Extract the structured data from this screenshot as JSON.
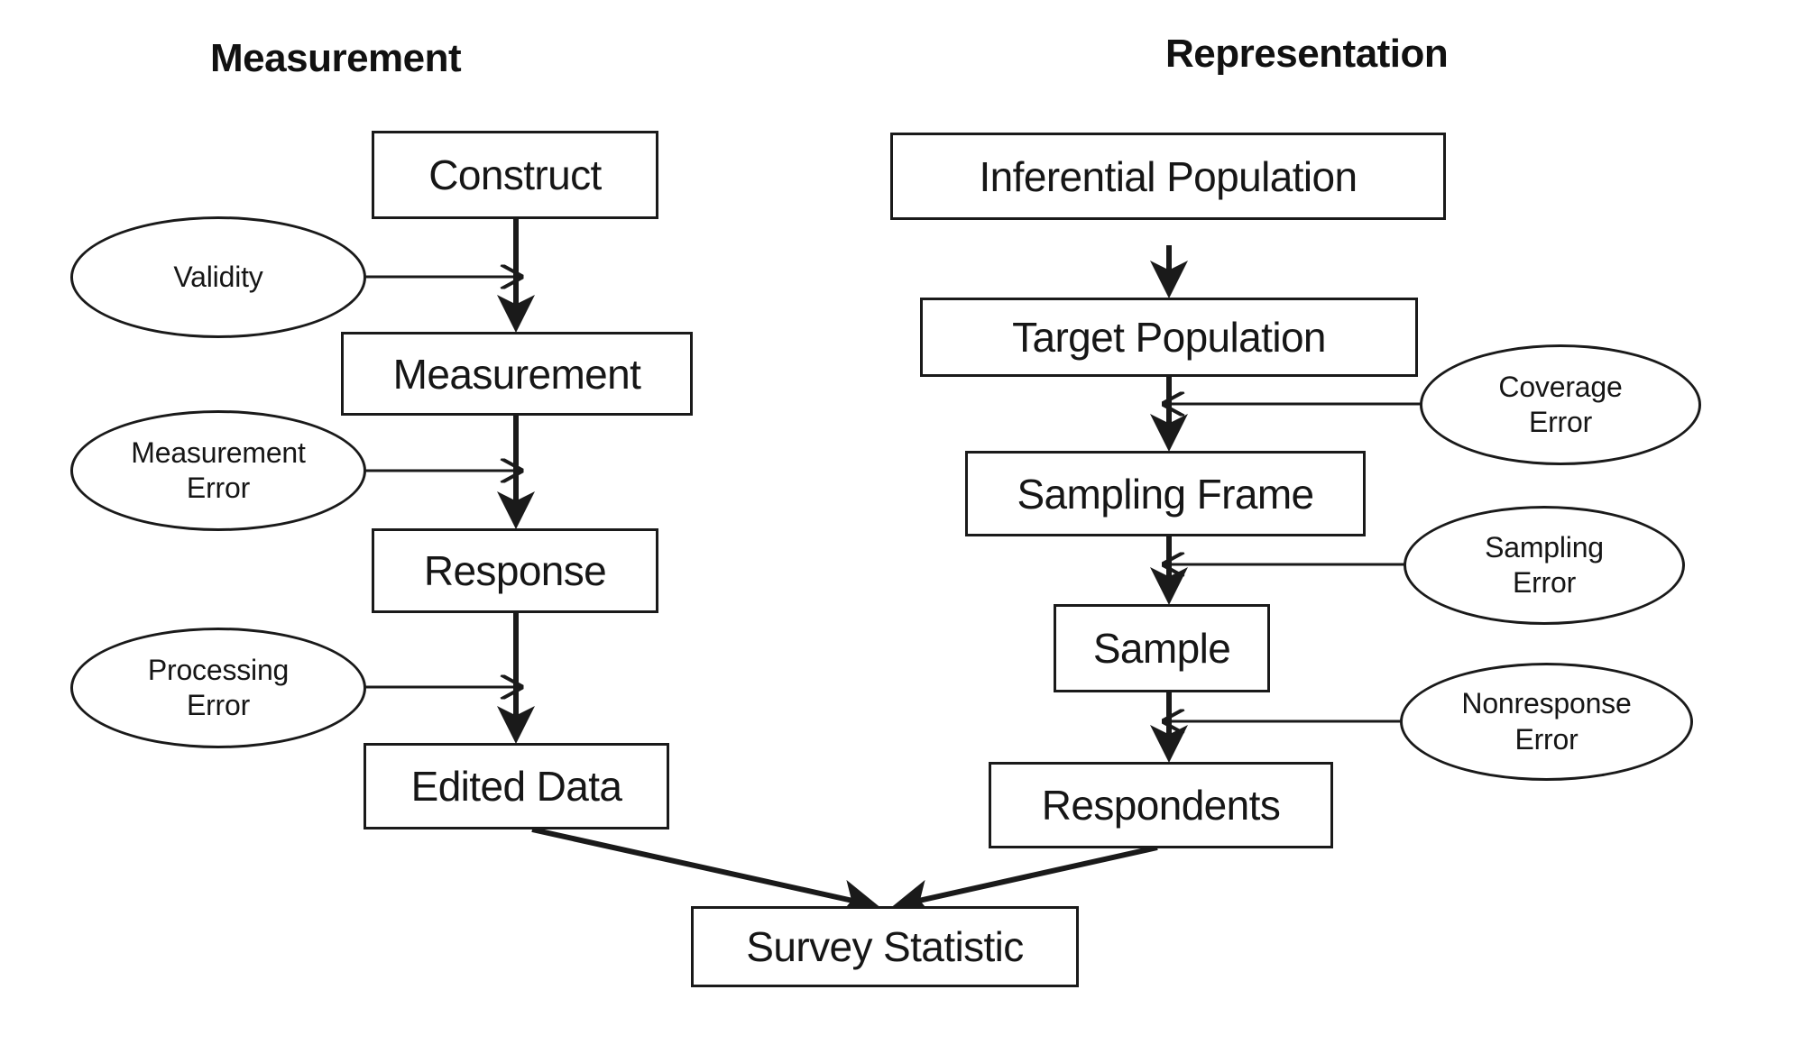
{
  "columns": {
    "left": {
      "title": "Measurement"
    },
    "right": {
      "title": "Representation"
    }
  },
  "measurement_chain": {
    "nodes": [
      {
        "id": "construct",
        "label": "Construct"
      },
      {
        "id": "measurement",
        "label": "Measurement"
      },
      {
        "id": "response",
        "label": "Response"
      },
      {
        "id": "edited-data",
        "label": "Edited Data"
      }
    ],
    "error_sources": [
      {
        "id": "validity",
        "label": "Validity"
      },
      {
        "id": "measurement-error",
        "label": "Measurement\nError"
      },
      {
        "id": "processing-error",
        "label": "Processing\nError"
      }
    ]
  },
  "representation_chain": {
    "nodes": [
      {
        "id": "inferential-population",
        "label": "Inferential Population"
      },
      {
        "id": "target-population",
        "label": "Target Population"
      },
      {
        "id": "sampling-frame",
        "label": "Sampling Frame"
      },
      {
        "id": "sample",
        "label": "Sample"
      },
      {
        "id": "respondents",
        "label": "Respondents"
      }
    ],
    "error_sources": [
      {
        "id": "coverage-error",
        "label": "Coverage\nError"
      },
      {
        "id": "sampling-error",
        "label": "Sampling\nError"
      },
      {
        "id": "nonresponse-error",
        "label": "Nonresponse\nError"
      }
    ]
  },
  "outcome": {
    "id": "survey-statistic",
    "label": "Survey Statistic"
  },
  "colors": {
    "stroke": "#1a1a1a",
    "text": "#161616",
    "background": "#ffffff"
  }
}
